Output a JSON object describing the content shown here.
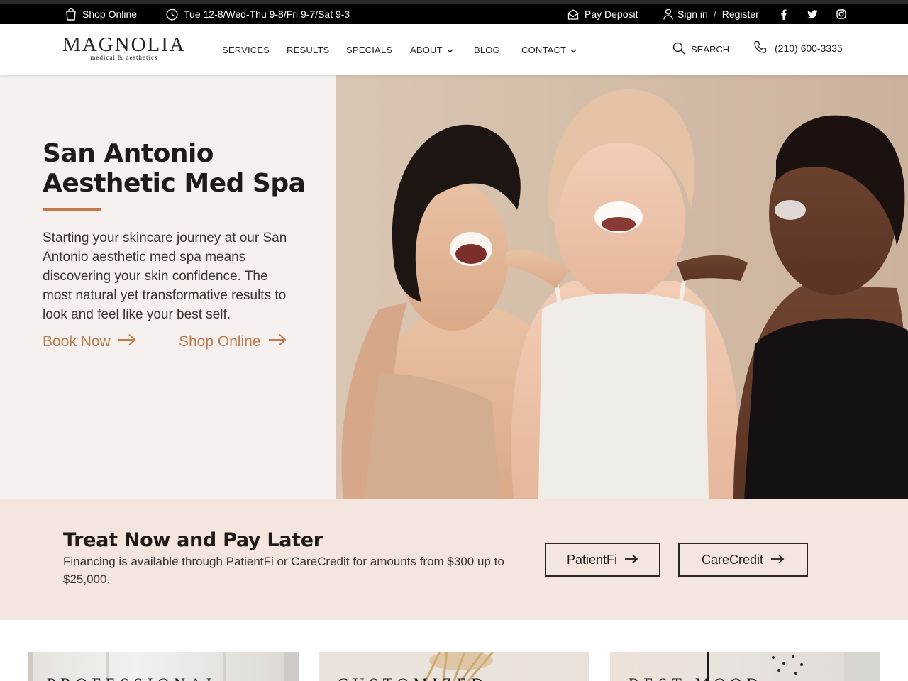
{
  "topbar": {
    "shop_online": "Shop Online",
    "hours": "Tue 12-8/Wed-Thu 9-8/Fri 9-7/Sat 9-3",
    "pay_deposit": "Pay Deposit",
    "sign_in": "Sign in",
    "separator": "/",
    "register": "Register",
    "social_icons": [
      "facebook-icon",
      "twitter-icon",
      "instagram-icon"
    ]
  },
  "header": {
    "logo_main": "MAGNOLIA",
    "logo_sub": "medical & aesthetics",
    "nav": {
      "services": "SERVICES",
      "results": "RESULTS",
      "specials": "SPECIALS",
      "about": "ABOUT",
      "blog": "BLOG",
      "contact": "CONTACT"
    },
    "search_label": "SEARCH",
    "phone": "(210) 600-3335"
  },
  "hero": {
    "title": "San Antonio Aesthetic Med Spa",
    "body": "Starting your skincare journey at our San Antonio aesthetic med spa means discovering your skin confidence. The most natural yet transformative results to look and feel like your best self.",
    "book_now": "Book Now",
    "shop_online": "Shop Online"
  },
  "financing": {
    "title": "Treat Now and Pay Later",
    "body": "Financing is available through PatientFi or CareCredit for amounts from $300 up to $25,000.",
    "patientfi": "PatientFi",
    "carecredit": "CareCredit"
  },
  "cards": {
    "card1": "PROFESSIONAL",
    "card2": "CUSTOMIZED",
    "card3": "BEST MOOD"
  },
  "colors": {
    "accent": "#c07a4f",
    "hero_bg": "#f6f1ef",
    "finance_bg": "#f4e5de",
    "topbar_bg": "#000000"
  }
}
